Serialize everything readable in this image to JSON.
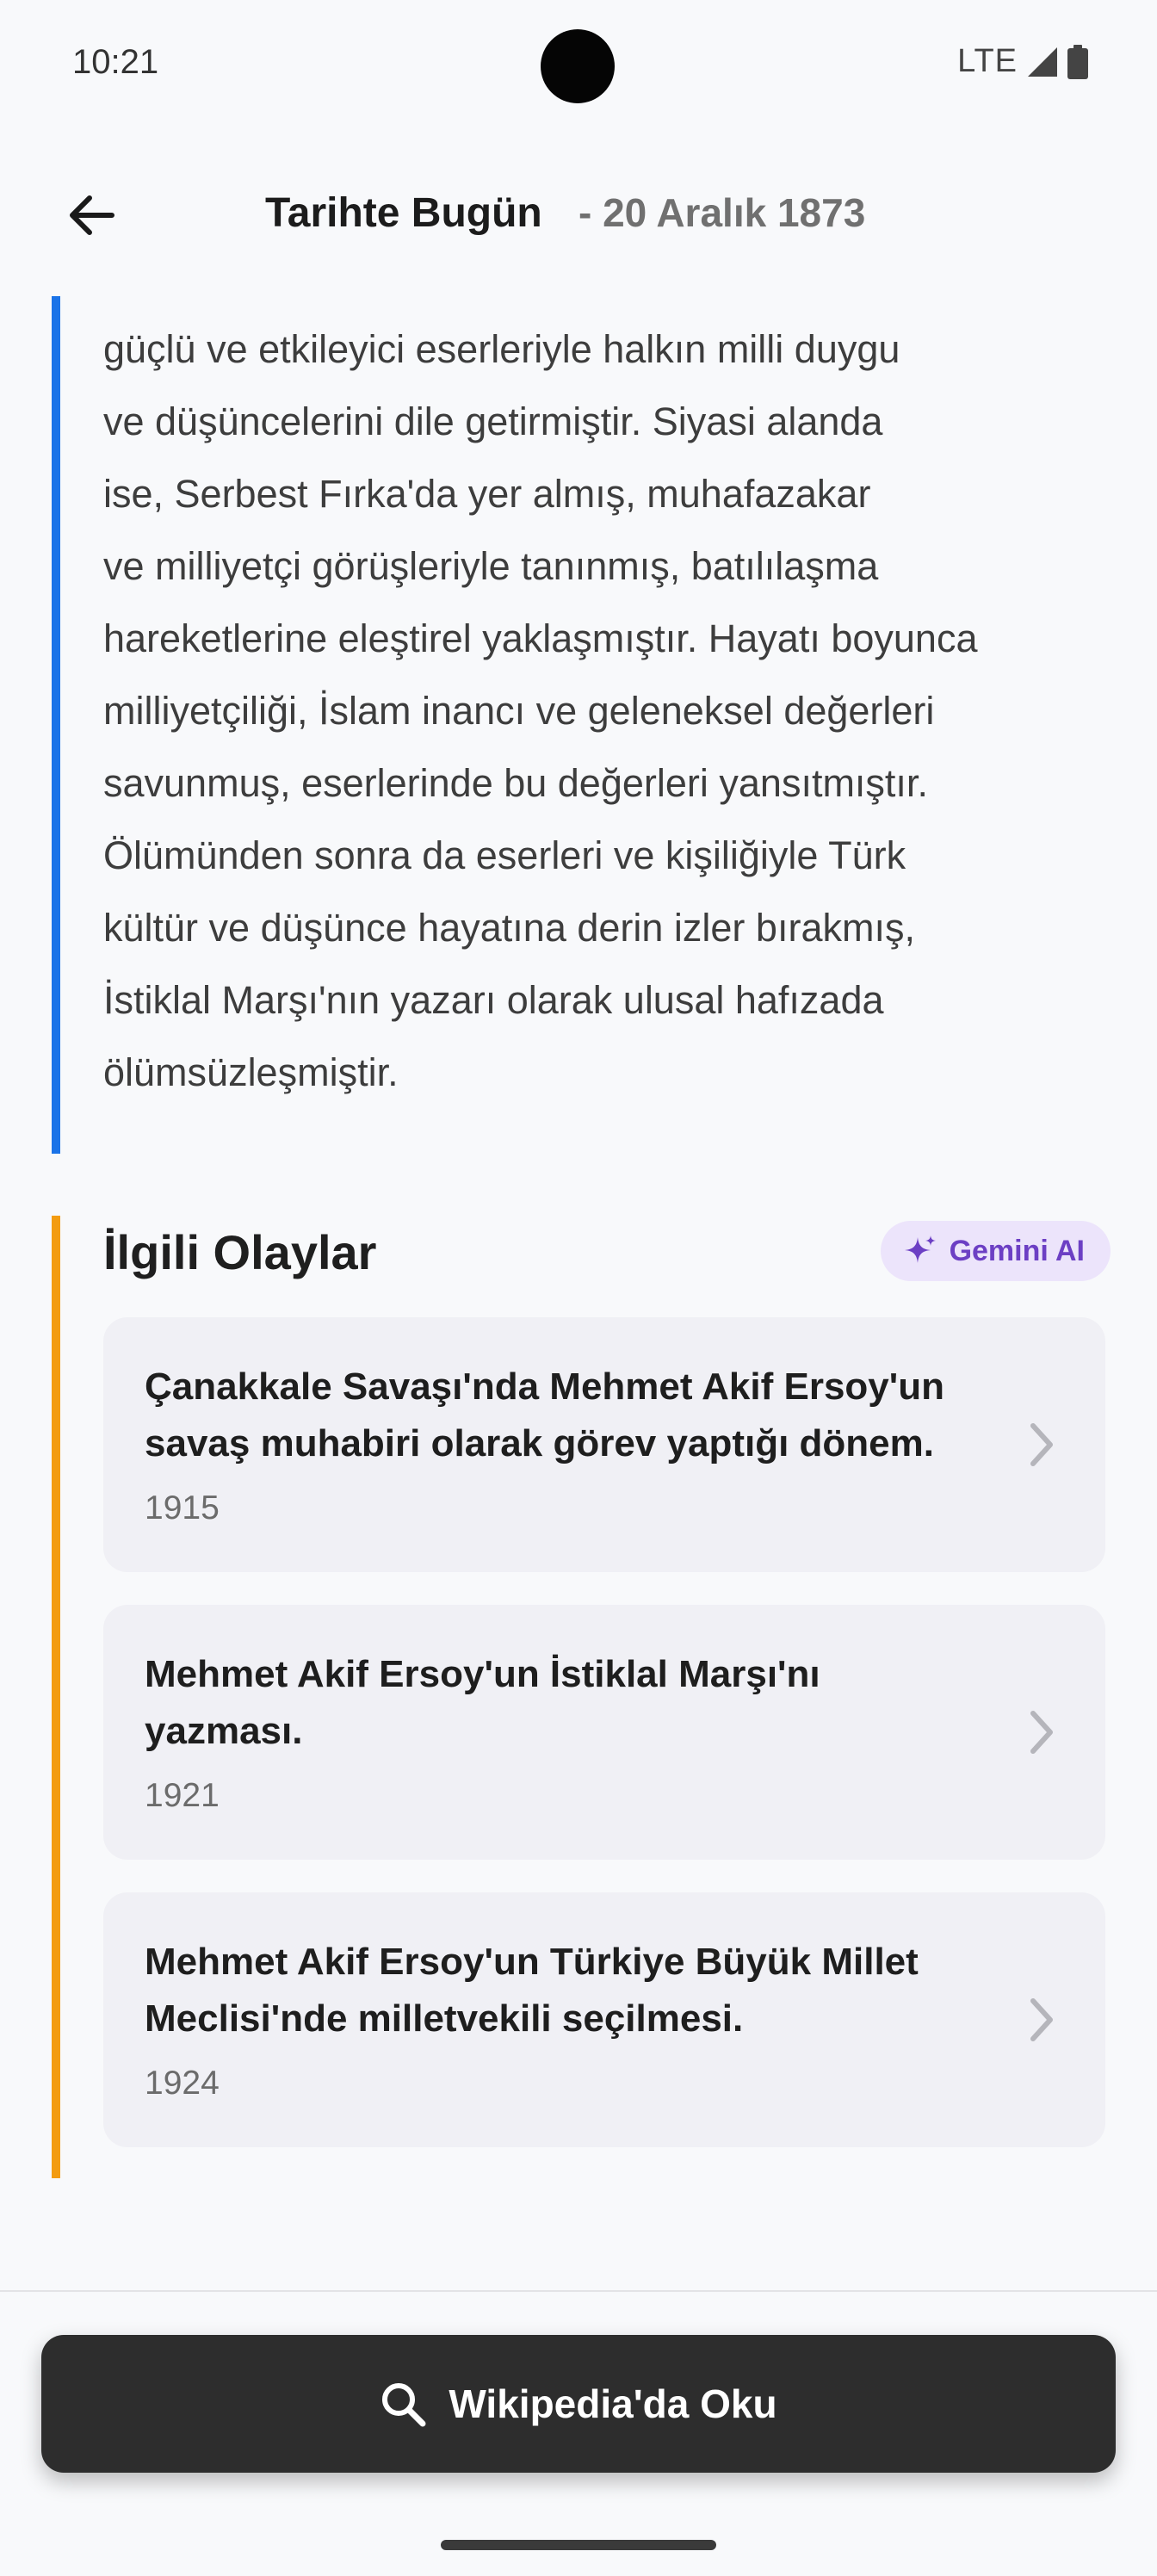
{
  "status_bar": {
    "time": "10:21",
    "network": "LTE"
  },
  "header": {
    "title": "Tarihte Bugün",
    "date": "- 20 Aralık 1873"
  },
  "biography": {
    "text": "güçlü ve etkileyici eserleriyle halkın milli duygu\nve düşüncelerini dile getirmiştir.  Siyasi alanda\nise,  Serbest Fırka'da yer almış,  muhafazakar\nve milliyetçi görüşleriyle tanınmış,  batılılaşma\nhareketlerine eleştirel yaklaşmıştır.  Hayatı boyunca\nmilliyetçiliği, İslam inancı ve geleneksel değerleri\nsavunmuş, eserlerinde bu değerleri yansıtmıştır.\nÖlümünden sonra da eserleri ve kişiliğiyle Türk\nkültür ve düşünce hayatına derin izler bırakmış,\nİstiklal Marşı'nın yazarı olarak ulusal hafızada\nölümsüzleşmiştir."
  },
  "related": {
    "title": "İlgili Olaylar",
    "badge": "Gemini AI",
    "events": [
      {
        "title": "Çanakkale Savaşı'nda Mehmet Akif Ersoy'un savaş muhabiri olarak görev yaptığı dönem.",
        "year": "1915"
      },
      {
        "title": "Mehmet Akif Ersoy'un İstiklal Marşı'nı yazması.",
        "year": "1921"
      },
      {
        "title": "Mehmet Akif Ersoy'un Türkiye Büyük Millet Meclisi'nde milletvekili seçilmesi.",
        "year": "1924"
      }
    ]
  },
  "footer": {
    "button_label": "Wikipedia'da Oku"
  },
  "colors": {
    "accent_blue": "#1a73e8",
    "accent_orange": "#f39c12",
    "badge_purple": "#6c3fc4"
  },
  "icons": {
    "back": "arrow-left-icon",
    "sparkle": "sparkle-icon",
    "chevron": "chevron-right-icon",
    "search": "search-icon"
  }
}
